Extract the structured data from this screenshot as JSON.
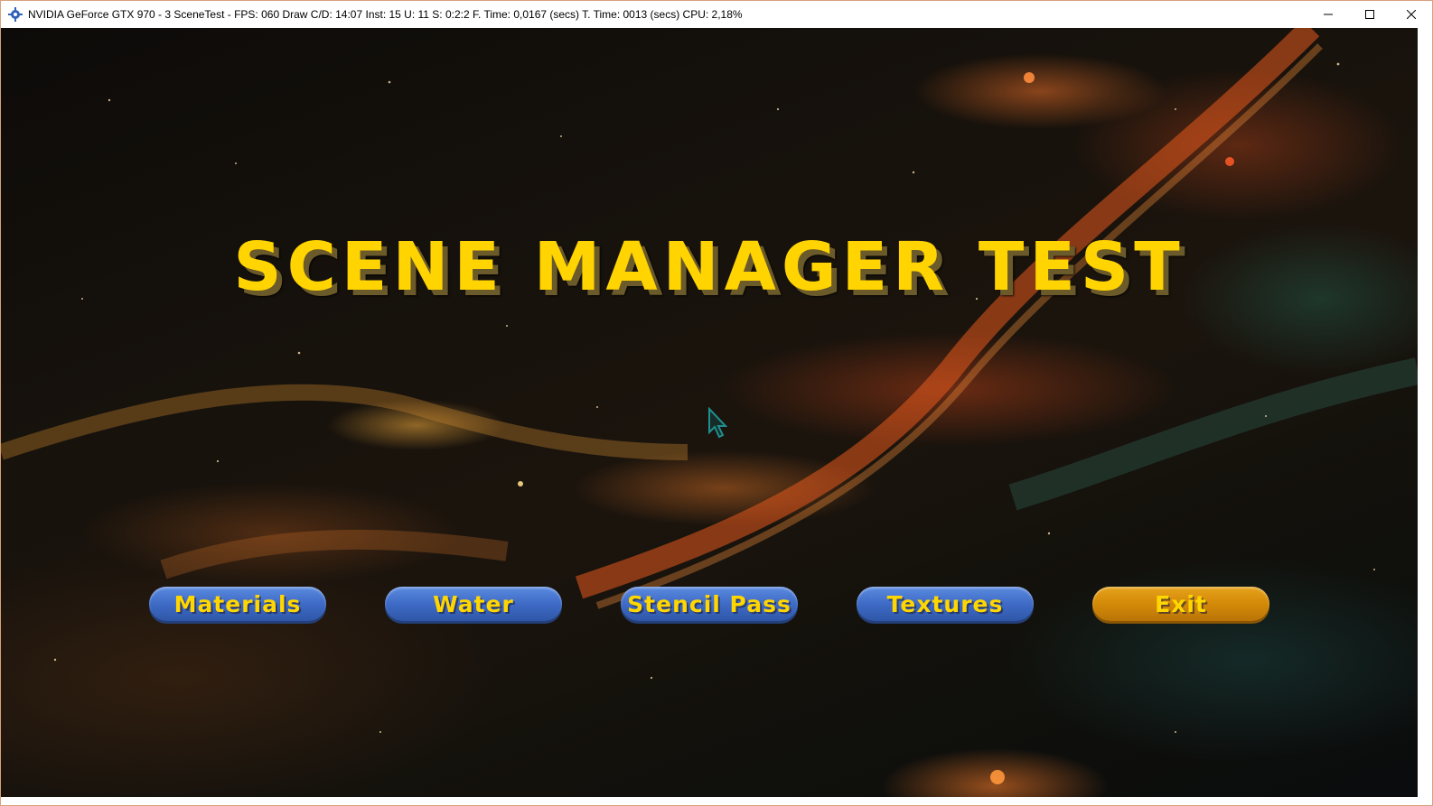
{
  "window": {
    "title": "NVIDIA GeForce GTX 970 - 3 SceneTest - FPS: 060 Draw C/D: 14:07 Inst: 15 U: 11 S: 0:2:2 F. Time: 0,0167 (secs) T. Time: 0013 (secs) CPU: 2,18%",
    "icon": "gear-icon",
    "controls": [
      "minimize-icon",
      "maximize-icon",
      "close-icon"
    ]
  },
  "scene": {
    "title": "SCENE MANAGER TEST"
  },
  "menu": {
    "buttons": [
      {
        "label": "Materials",
        "color": "#3e6bc6"
      },
      {
        "label": "Water",
        "color": "#3e6bc6"
      },
      {
        "label": "Stencil Pass",
        "color": "#3e6bc6"
      },
      {
        "label": "Textures",
        "color": "#3e6bc6"
      },
      {
        "label": "Exit",
        "color": "#d48a08"
      }
    ]
  },
  "colors": {
    "title_text": "#ffd400",
    "button_text": "#ffd600",
    "cursor": "#1f8f8f"
  }
}
